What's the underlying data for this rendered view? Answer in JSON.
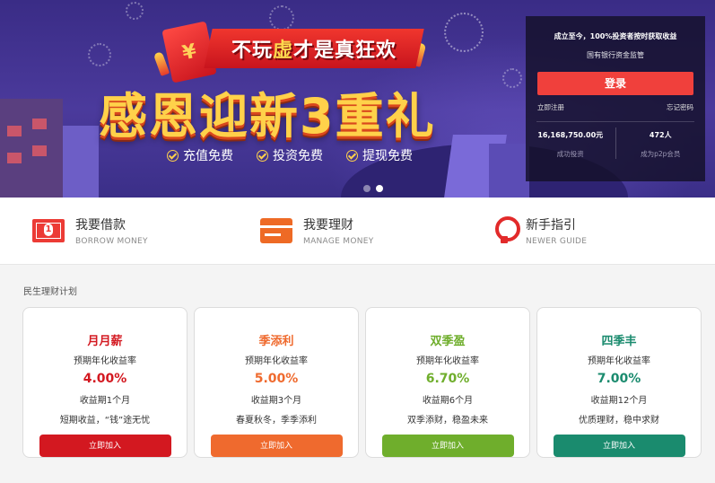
{
  "banner": {
    "envelope_mark": "¥",
    "ribbon_pre": "不玩",
    "ribbon_hl": "虚",
    "ribbon_post": "才是真狂欢",
    "headline": "感恩迎新3重礼",
    "perks": [
      "充值免费",
      "投资免费",
      "提现免费"
    ],
    "slides": 2,
    "active_slide": 2,
    "colors": {
      "headline": "#ffd14a",
      "ribbon": "#e0242b"
    }
  },
  "login_panel": {
    "slogan": "成立至今，100%投资者按时获取收益",
    "sub": "国有银行资金监管",
    "login_label": "登录",
    "register_link": "立即注册",
    "forgot_link": "忘记密码",
    "stats": [
      {
        "value": "16,168,750.00元",
        "label": "成功投资"
      },
      {
        "value": "472人",
        "label": "成为p2p会员"
      }
    ]
  },
  "nav": [
    {
      "title": "我要借款",
      "en": "BORROW MONEY",
      "icon": "money-icon"
    },
    {
      "title": "我要理财",
      "en": "MANAGE MONEY",
      "icon": "card-icon"
    },
    {
      "title": "新手指引",
      "en": "NEWER GUIDE",
      "icon": "bulb-icon"
    }
  ],
  "products": {
    "section_title": "民生理财计划",
    "items": [
      {
        "name": "月月薪",
        "rate_label": "预期年化收益率",
        "rate": "4.00%",
        "term": "收益期1个月",
        "slogan": "短期收益，“钱”途无忧",
        "cta": "立即加入",
        "color": "#d31820"
      },
      {
        "name": "季添利",
        "rate_label": "预期年化收益率",
        "rate": "5.00%",
        "term": "收益期3个月",
        "slogan": "春夏秋冬，季季添利",
        "cta": "立即加入",
        "color": "#ef6a2e"
      },
      {
        "name": "双季盈",
        "rate_label": "预期年化收益率",
        "rate": "6.70%",
        "term": "收益期6个月",
        "slogan": "双季添财，稳盈未来",
        "cta": "立即加入",
        "color": "#6fae2c"
      },
      {
        "name": "四季丰",
        "rate_label": "预期年化收益率",
        "rate": "7.00%",
        "term": "收益期12个月",
        "slogan": "优质理财，稳中求财",
        "cta": "立即加入",
        "color": "#1a8b6e"
      }
    ]
  }
}
